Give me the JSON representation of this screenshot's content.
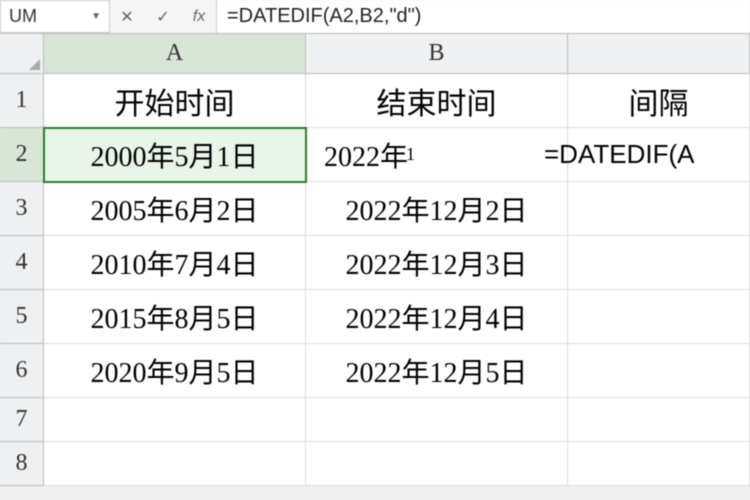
{
  "formula_bar": {
    "name_box": "UM",
    "cancel": "✕",
    "confirm": "✓",
    "fx": "fx",
    "formula": "=DATEDIF(A2,B2,\"d\")"
  },
  "columns": [
    "A",
    "B",
    "C_partial"
  ],
  "col_labels": {
    "A": "A",
    "B": "B",
    "C_partial": ""
  },
  "rows": [
    "1",
    "2",
    "3",
    "4",
    "5",
    "6",
    "7",
    "8"
  ],
  "cells": {
    "A1": "开始时间",
    "B1": "结束时间",
    "C1": "间隔",
    "A2": "2000年5月1日",
    "B2": "2022年",
    "C2": "=DATEDIF(A",
    "A3": "2005年6月2日",
    "B3": "2022年12月2日",
    "A4": "2010年7月4日",
    "B4": "2022年12月3日",
    "A5": "2015年8月5日",
    "B5": "2022年12月4日",
    "A6": "2020年9月5日",
    "B6": "2022年12月5日"
  },
  "b2_partial_marker": "1"
}
